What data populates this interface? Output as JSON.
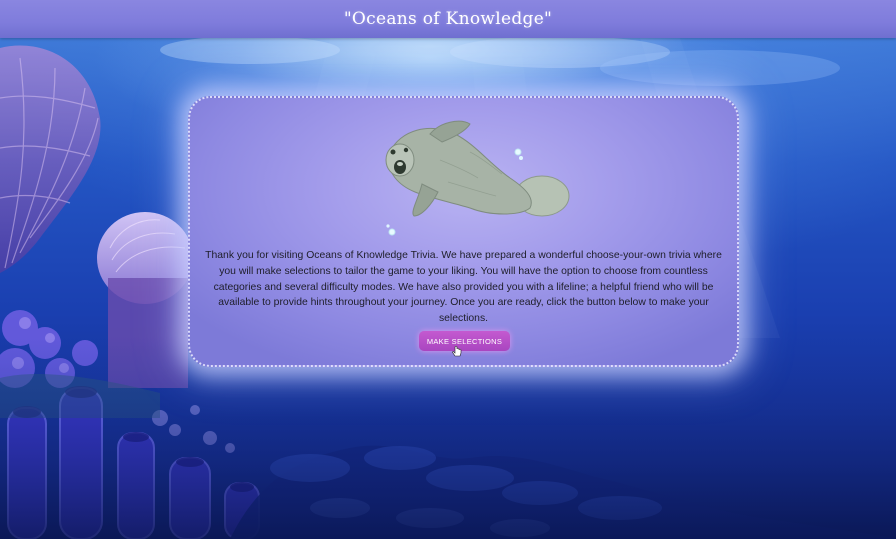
{
  "header": {
    "title": "\"Oceans of Knowledge\""
  },
  "intro": {
    "text": "Thank you for visiting Oceans of Knowledge Trivia. We have prepared a wonderful choose-your-own trivia where you will make selections to tailor the game to your liking. You will have the option to choose from countless categories and several difficulty modes. We have also provided you with a lifeline; a helpful friend who will be available to provide hints throughout your journey. Once you are ready, click the button below to make your selections.",
    "button_label": "MAKE SELECTIONS"
  },
  "mascot": {
    "icon": "manatee-icon"
  },
  "colors": {
    "header": "#8a86e0",
    "card": "#a39ceb",
    "button": "#b650c8",
    "ocean": "#1a3fb0"
  }
}
